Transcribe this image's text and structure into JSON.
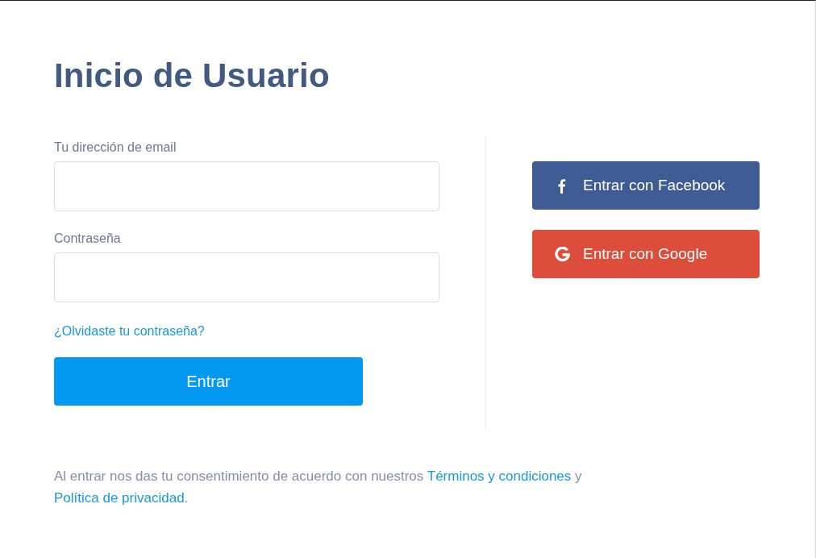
{
  "title": "Inicio de Usuario",
  "form": {
    "fields": [
      {
        "label": "Tu dirección de email"
      },
      {
        "label": "Contraseña"
      }
    ],
    "forgot_link": "¿Olvidaste tu contraseña?",
    "submit": "Entrar"
  },
  "social_buttons": [
    {
      "kind": "facebook",
      "label": "Entrar con Facebook",
      "color": "#3f5b93"
    },
    {
      "kind": "google",
      "label": "Entrar con Google",
      "color": "#dd4d3b"
    }
  ],
  "footer": {
    "parts": [
      {
        "kind": "text",
        "text": "Al entrar nos das tu consentimiento de acuerdo con nuestros "
      },
      {
        "kind": "link",
        "text": "Términos y condiciones"
      },
      {
        "kind": "text",
        "text": " y "
      },
      {
        "kind": "link",
        "text": "Política de privacidad"
      },
      {
        "kind": "text",
        "text": "."
      }
    ]
  }
}
